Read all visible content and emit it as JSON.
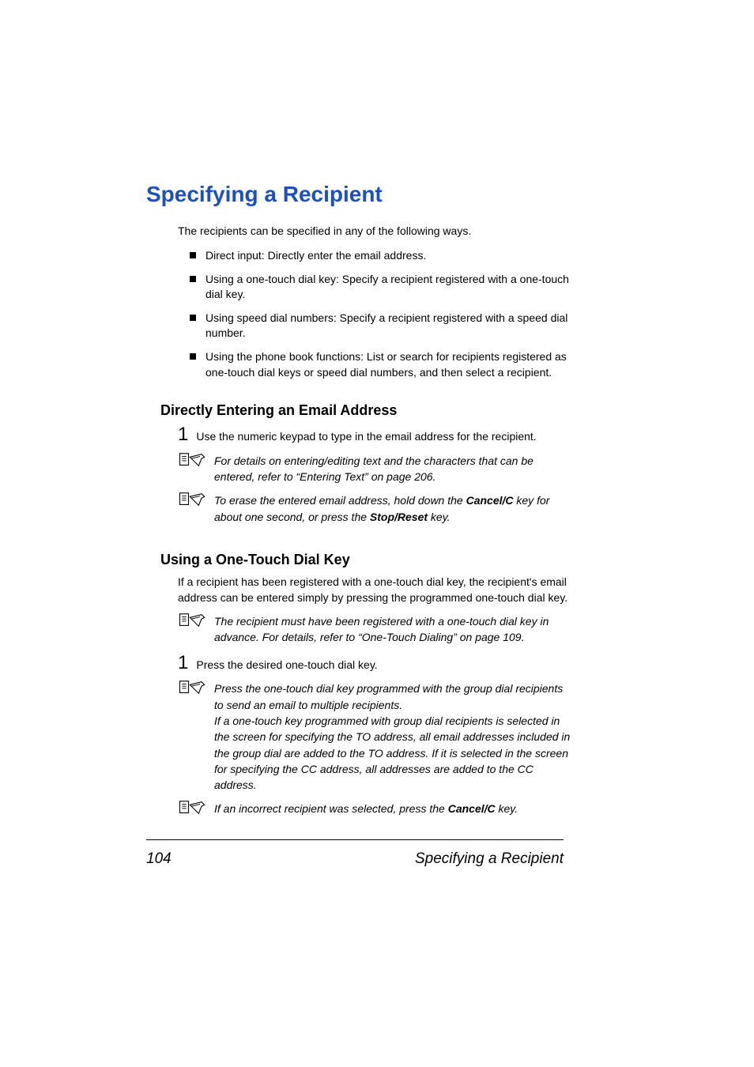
{
  "main_heading": "Specifying a Recipient",
  "intro": "The recipients can be specified in any of the following ways.",
  "bullets": [
    "Direct input: Directly enter the email address.",
    "Using a one-touch dial key: Specify a recipient registered with a one-touch dial key.",
    "Using speed dial numbers: Specify a recipient registered with a speed dial number.",
    "Using the phone book functions: List or search for recipients registered as one-touch dial keys or speed dial numbers, and then select a recipient."
  ],
  "section1": {
    "heading": "Directly Entering an Email Address",
    "step1_num": "1",
    "step1_text": "Use the numeric keypad to type in the email address for the recipient.",
    "note1": "For details on entering/editing text and the characters that can be entered, refer to “Entering Text” on page 206.",
    "note2_pre": "To erase the entered email address, hold down the ",
    "note2_bold1": "Cancel/C",
    "note2_mid": " key for about one second, or press the ",
    "note2_bold2": "Stop/Reset",
    "note2_end": " key."
  },
  "section2": {
    "heading": "Using a One-Touch Dial Key",
    "para": "If a recipient has been registered with a one-touch dial key, the recipient's email address can be entered simply by pressing the programmed one-touch dial key.",
    "note1": "The recipient must have been registered with a one-touch dial key in advance. For details, refer to “One-Touch Dialing” on page 109.",
    "step1_num": "1",
    "step1_text": "Press the desired one-touch dial key.",
    "note2": "Press the one-touch dial key programmed with the group dial recipients to send an email to multiple recipients.\nIf a one-touch key programmed with group dial recipients is selected in the screen for specifying the TO address, all email addresses included in the group dial are added to the TO address. If it is selected in the screen for specifying the CC address, all addresses are added to the CC address.",
    "note3_pre": "If an incorrect recipient was selected, press the ",
    "note3_bold": "Cancel/C",
    "note3_end": " key."
  },
  "footer": {
    "page": "104",
    "title": "Specifying a Recipient"
  }
}
